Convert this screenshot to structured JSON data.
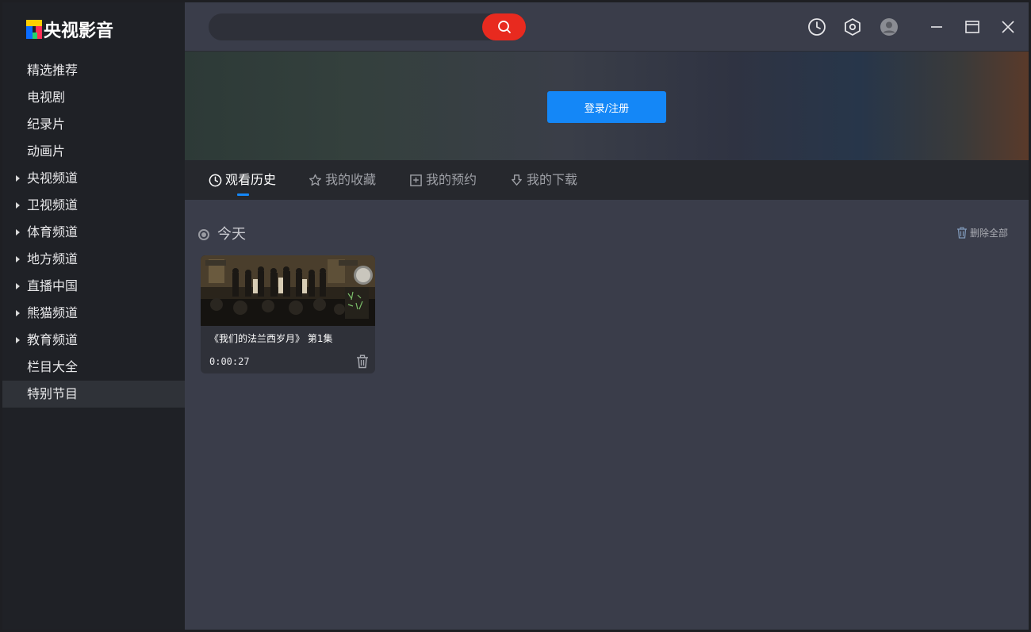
{
  "app": {
    "logo_text": "央视影音"
  },
  "sidebar": {
    "items": [
      {
        "label": "精选推荐",
        "expandable": false,
        "active": false
      },
      {
        "label": "电视剧",
        "expandable": false,
        "active": false
      },
      {
        "label": "纪录片",
        "expandable": false,
        "active": false
      },
      {
        "label": "动画片",
        "expandable": false,
        "active": false
      },
      {
        "label": "央视频道",
        "expandable": true,
        "active": false
      },
      {
        "label": "卫视频道",
        "expandable": true,
        "active": false
      },
      {
        "label": "体育频道",
        "expandable": true,
        "active": false
      },
      {
        "label": "地方频道",
        "expandable": true,
        "active": false
      },
      {
        "label": "直播中国",
        "expandable": true,
        "active": false
      },
      {
        "label": "熊猫频道",
        "expandable": true,
        "active": false
      },
      {
        "label": "教育频道",
        "expandable": true,
        "active": false
      },
      {
        "label": "栏目大全",
        "expandable": false,
        "active": false
      },
      {
        "label": "特别节目",
        "expandable": false,
        "active": true
      }
    ]
  },
  "search": {
    "placeholder": "",
    "value": ""
  },
  "banner": {
    "login_label": "登录/注册"
  },
  "tabs": [
    {
      "label": "观看历史",
      "icon": "clock-icon",
      "active": true
    },
    {
      "label": "我的收藏",
      "icon": "star-icon",
      "active": false
    },
    {
      "label": "我的预约",
      "icon": "calendar-plus-icon",
      "active": false
    },
    {
      "label": "我的下载",
      "icon": "download-icon",
      "active": false
    }
  ],
  "history": {
    "section_title": "今天",
    "delete_all_label": "删除全部",
    "items": [
      {
        "title": "《我们的法兰西岁月》 第1集",
        "time": "0:00:27"
      }
    ]
  },
  "colors": {
    "accent": "#1487f7",
    "search_button": "#e82a1f",
    "sidebar_bg": "#1f2126",
    "content_bg": "#3a3d4a"
  }
}
